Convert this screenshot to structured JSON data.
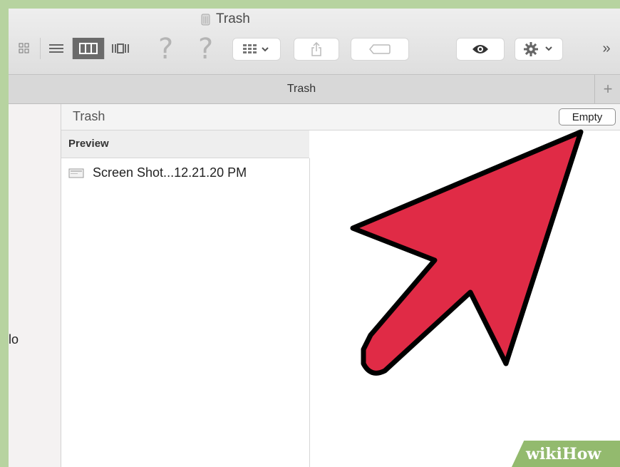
{
  "window": {
    "title": "Trash"
  },
  "toolbar": {
    "view_buttons": [
      "icon-view",
      "list-view",
      "column-view",
      "cover-flow-view"
    ],
    "help_mark_1": "?",
    "help_mark_2": "?",
    "more_label": "»"
  },
  "tab": {
    "label": "Trash",
    "new_tab_label": "+"
  },
  "sidebar": {
    "partial_text": "lo"
  },
  "pathbar": {
    "title": "Trash",
    "empty_button": "Empty"
  },
  "column": {
    "header": "Preview",
    "items": [
      {
        "name": "Screen Shot...12.21.20 PM"
      }
    ]
  },
  "watermark": {
    "part1": "wiki",
    "part2": "How"
  },
  "colors": {
    "arrow_fill": "#e02b46",
    "arrow_stroke": "#000000",
    "frame": "#b7d3a0"
  }
}
